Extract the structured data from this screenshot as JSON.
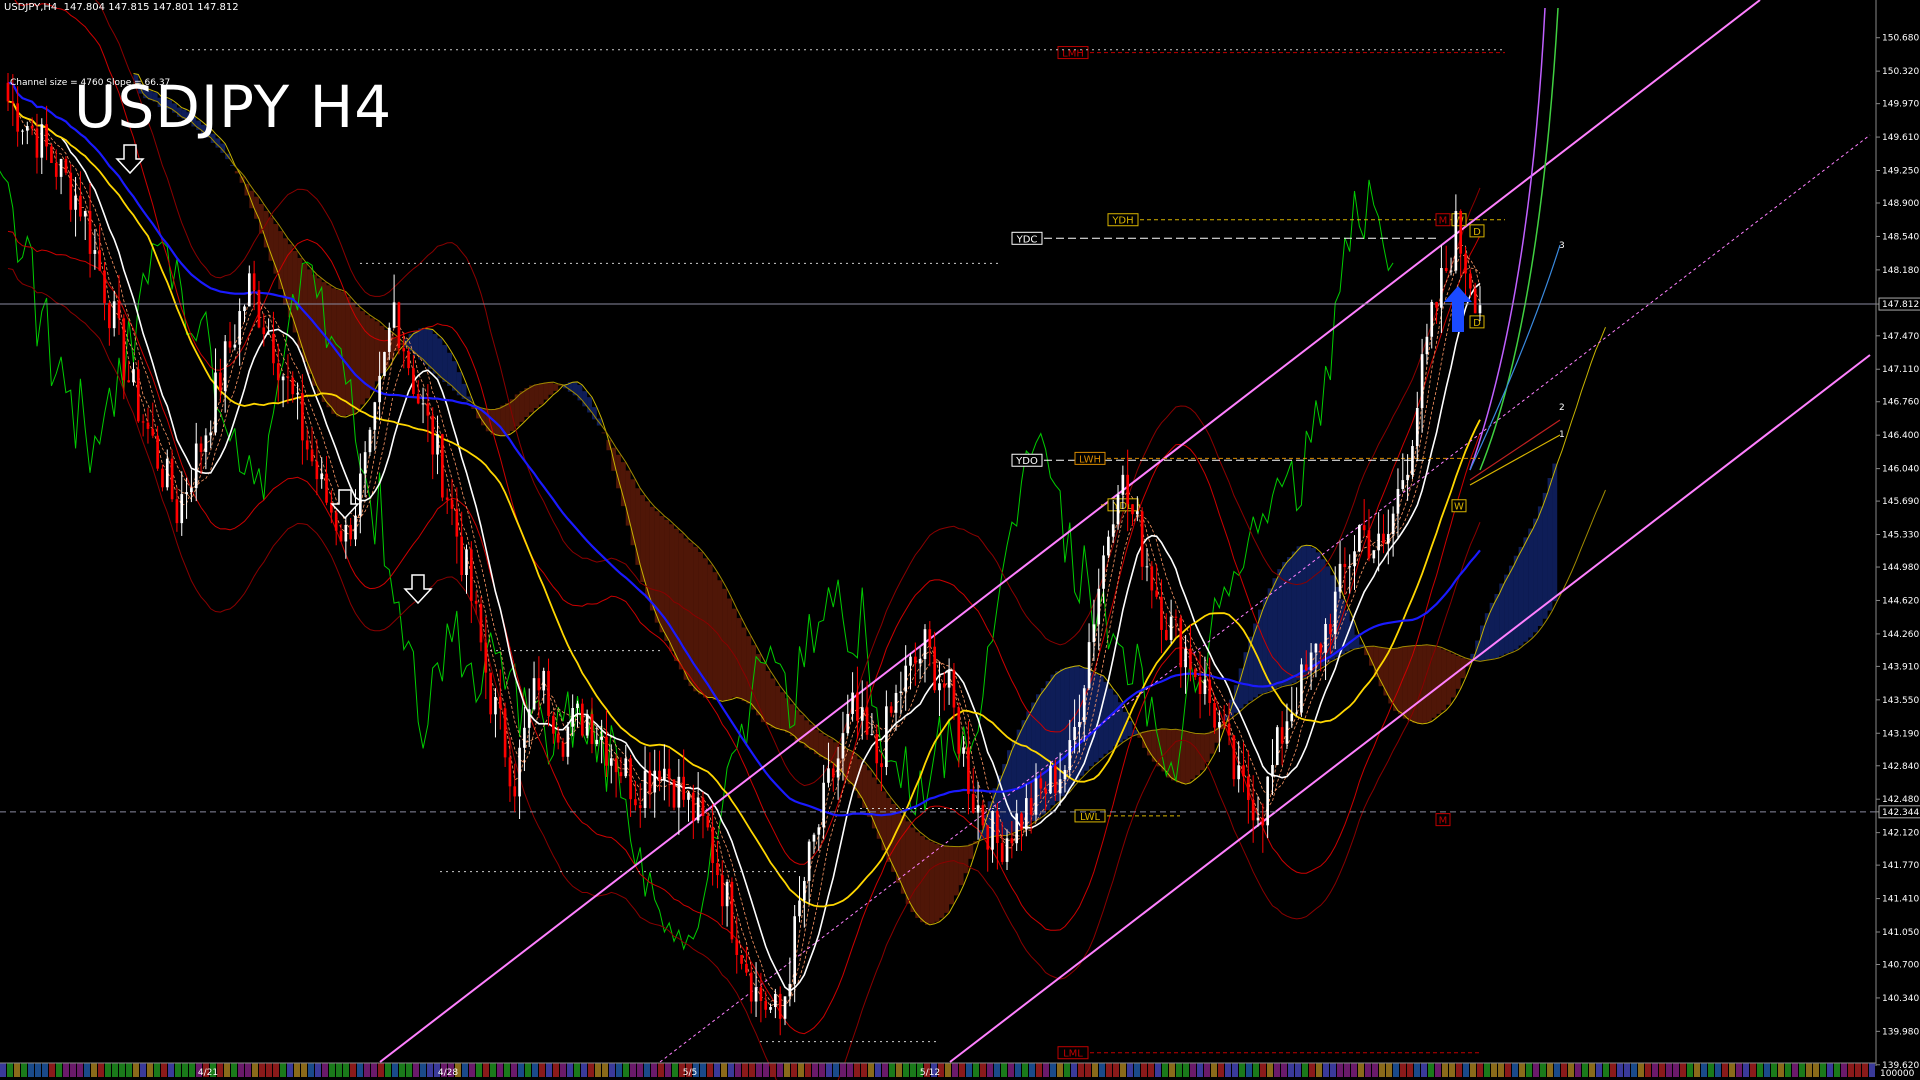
{
  "header": {
    "symbol_tf": "USDJPY,H4",
    "ohlc": "147.804 147.815 147.801 147.812"
  },
  "channel_info": "Channel size = 4760 Slope = 66.37",
  "title": "USDJPY H4",
  "colors": {
    "background": "#000000",
    "bull": "#ffffff",
    "bear": "#ff0000",
    "ma_blue": "#1a1aff",
    "ma_yellow": "#ffd700",
    "ma_white": "#ffffff",
    "channel": "#ff80ff",
    "chikou": "#00cc00",
    "bollinger": "#cc0000",
    "kumo_bear": "#b03010",
    "kumo_bull": "#2040c0"
  },
  "chart_data": {
    "type": "candlestick",
    "title": "USDJPY H4",
    "ylim": [
      139.65,
      151.0
    ],
    "y_ticks": [
      "150.680",
      "150.320",
      "149.970",
      "149.610",
      "149.250",
      "148.900",
      "148.540",
      "148.180",
      "147.812",
      "147.470",
      "147.110",
      "146.760",
      "146.400",
      "146.040",
      "145.690",
      "145.330",
      "144.980",
      "144.620",
      "144.260",
      "143.910",
      "143.550",
      "143.190",
      "142.840",
      "142.480",
      "142.344",
      "142.120",
      "141.770",
      "141.410",
      "141.050",
      "140.700",
      "140.340",
      "139.980",
      "139.620"
    ],
    "current_price": "147.812",
    "marked_price": "142.344",
    "x_ticks": [
      "4/21",
      "4/28",
      "5/5",
      "5/12"
    ],
    "volume_scale": "100000",
    "close_path": [
      150.0,
      149.7,
      149.3,
      148.9,
      148.0,
      147.0,
      146.3,
      145.6,
      146.3,
      147.2,
      148.0,
      147.4,
      146.6,
      145.8,
      145.3,
      146.2,
      147.8,
      146.8,
      146.0,
      144.9,
      143.6,
      142.7,
      143.8,
      143.2,
      143.4,
      143.0,
      142.6,
      142.9,
      142.5,
      142.1,
      141.2,
      140.4,
      140.1,
      141.6,
      142.6,
      143.4,
      142.9,
      143.7,
      144.1,
      143.6,
      142.5,
      142.0,
      142.3,
      142.6,
      142.9,
      144.5,
      146.0,
      145.2,
      144.4,
      144.0,
      143.4,
      142.6,
      142.4,
      143.4,
      143.9,
      144.6,
      145.4,
      145.1,
      146.2,
      147.6,
      148.6,
      147.8
    ],
    "levels": [
      {
        "label": "LMH",
        "value": 150.52
      },
      {
        "label": "YDH",
        "value": 148.72
      },
      {
        "label": "YDC",
        "value": 148.52
      },
      {
        "label": "YDO",
        "value": 146.13
      },
      {
        "label": "LWH",
        "value": 146.15
      },
      {
        "label": "YDL",
        "value": 145.65
      },
      {
        "label": "LWL",
        "value": 142.3
      },
      {
        "label": "LML",
        "value": 139.75
      },
      {
        "label": "M",
        "value": 148.72
      },
      {
        "label": "W",
        "value": 148.72
      },
      {
        "label": "D",
        "value": 148.6
      },
      {
        "label": "D",
        "value": 147.62
      },
      {
        "label": "W",
        "value": 145.64
      },
      {
        "label": "M",
        "value": 142.26
      }
    ],
    "projection_labels": [
      "3",
      "2",
      "1"
    ],
    "grid": false
  }
}
